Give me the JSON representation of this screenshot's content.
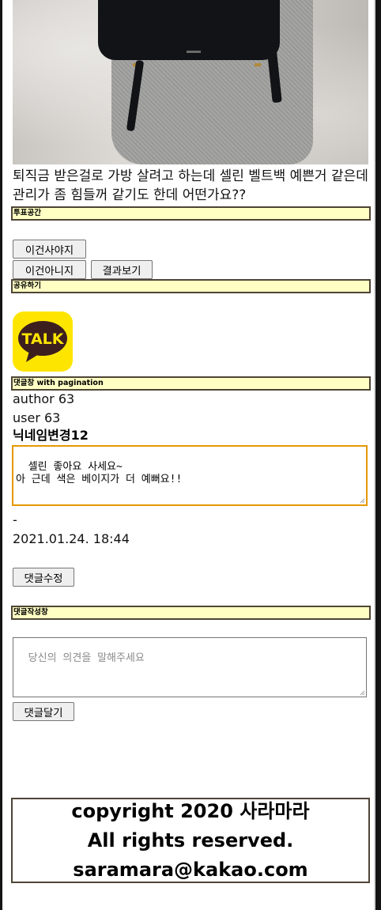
{
  "post": {
    "title": "퇴직금 받은걸로 가방 살려고 하는데 셀린 벨트백 예쁜거 같은데 관리가 좀 힘들꺼 같기도 한데 어떤가요??"
  },
  "sections": {
    "vote": "투표공간",
    "share": "공유하기",
    "comments": "댓글창 with pagination",
    "write": "댓글작성창"
  },
  "vote": {
    "yes_label": "이건사야지",
    "no_label": "이건아니지",
    "results_label": "결과보기"
  },
  "share": {
    "kakao_label": "TALK",
    "kakao_color": "#fee500"
  },
  "comment": {
    "author_line": "author 63",
    "user_line": "user 63",
    "nickname": "닉네임변경12",
    "content": "셀린 좋아요 사세요~\n아 근데 색은 베이지가 더 예뻐요!!",
    "dash": "-",
    "timestamp": "2021.01.24. 18:44",
    "edit_label": "댓글수정"
  },
  "write": {
    "placeholder": "당신의 의견을 말해주세요",
    "submit_label": "댓글달기"
  },
  "footer": {
    "line1": "copyright 2020 사라마라",
    "line2": "All rights reserved.",
    "line3": "saramara@kakao.com"
  },
  "colors": {
    "section_bar": "#ffffc4",
    "section_border": "#4e4436",
    "focus_border": "#e59700"
  }
}
